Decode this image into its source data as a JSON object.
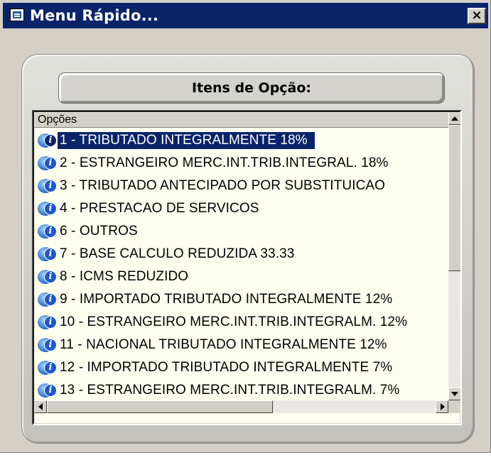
{
  "window": {
    "title": "Menu Rápido...",
    "close_glyph": "×",
    "icons": {
      "app": "app-window-icon",
      "close": "close-icon"
    }
  },
  "panel": {
    "header_label": "Itens de Opção:"
  },
  "list": {
    "column_header": "Opções",
    "selected_index": 0,
    "item_icon": "info-disk-icon",
    "items": [
      {
        "label": "1 - TRIBUTADO INTEGRALMENTE 18%"
      },
      {
        "label": "2 - ESTRANGEIRO MERC.INT.TRIB.INTEGRAL. 18%"
      },
      {
        "label": "3 - TRIBUTADO ANTECIPADO POR SUBSTITUICAO"
      },
      {
        "label": "4 - PRESTACAO DE SERVICOS"
      },
      {
        "label": "6 - OUTROS"
      },
      {
        "label": "7 - BASE CALCULO REDUZIDA 33.33"
      },
      {
        "label": "8 - ICMS REDUZIDO"
      },
      {
        "label": "9 - IMPORTADO TRIBUTADO INTEGRALMENTE 12%"
      },
      {
        "label": "10 - ESTRANGEIRO MERC.INT.TRIB.INTEGRALM. 12%"
      },
      {
        "label": "11 - NACIONAL TRIBUTADO INTEGRALMENTE 12%"
      },
      {
        "label": "12 - IMPORTADO TRIBUTADO INTEGRALMENTE 7%"
      },
      {
        "label": "13 - ESTRANGEIRO MERC.INT.TRIB.INTEGRALM. 7%"
      }
    ]
  },
  "scroll": {
    "vertical_position_fraction": 0.0,
    "horizontal_position_fraction": 0.0
  },
  "colors": {
    "titlebar": "#0a246a",
    "selection": "#0a246a",
    "list_background": "#fffff0",
    "window_face": "#d4d0c8"
  }
}
